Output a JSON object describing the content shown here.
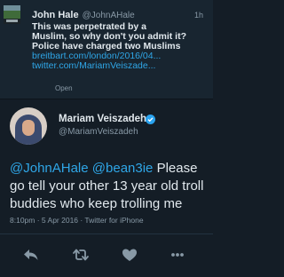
{
  "quoted_tweet": {
    "name": "John Hale",
    "handle": "@JohnAHale",
    "time": "1h",
    "lines": [
      "This was perpetrated by a",
      "Muslim, so why don't you admit it?",
      "Police have charged two Muslims"
    ],
    "links": [
      "breitbart.com/london/2016/04...",
      "twitter.com/MariamVeiszade..."
    ],
    "open_label": "Open"
  },
  "tweet": {
    "name": "Mariam Veiszadeh",
    "handle": "@MariamVeiszadeh",
    "mention1": "@JohnAHale",
    "mention2": "@bean3ie",
    "body": " Please go tell your other 13 year old troll buddies who keep trolling me",
    "timestamp": "8:10pm · 5 Apr 2016 · Twitter for iPhone"
  },
  "actions": [
    "reply-icon",
    "retweet-icon",
    "like-icon",
    "more-icon"
  ],
  "colors": {
    "background": "#141d26",
    "quoted_background": "#182530",
    "link": "#2fa6e7",
    "text": "#e1e8ed",
    "muted": "#8899a6",
    "verified": "#2aa3ef"
  }
}
